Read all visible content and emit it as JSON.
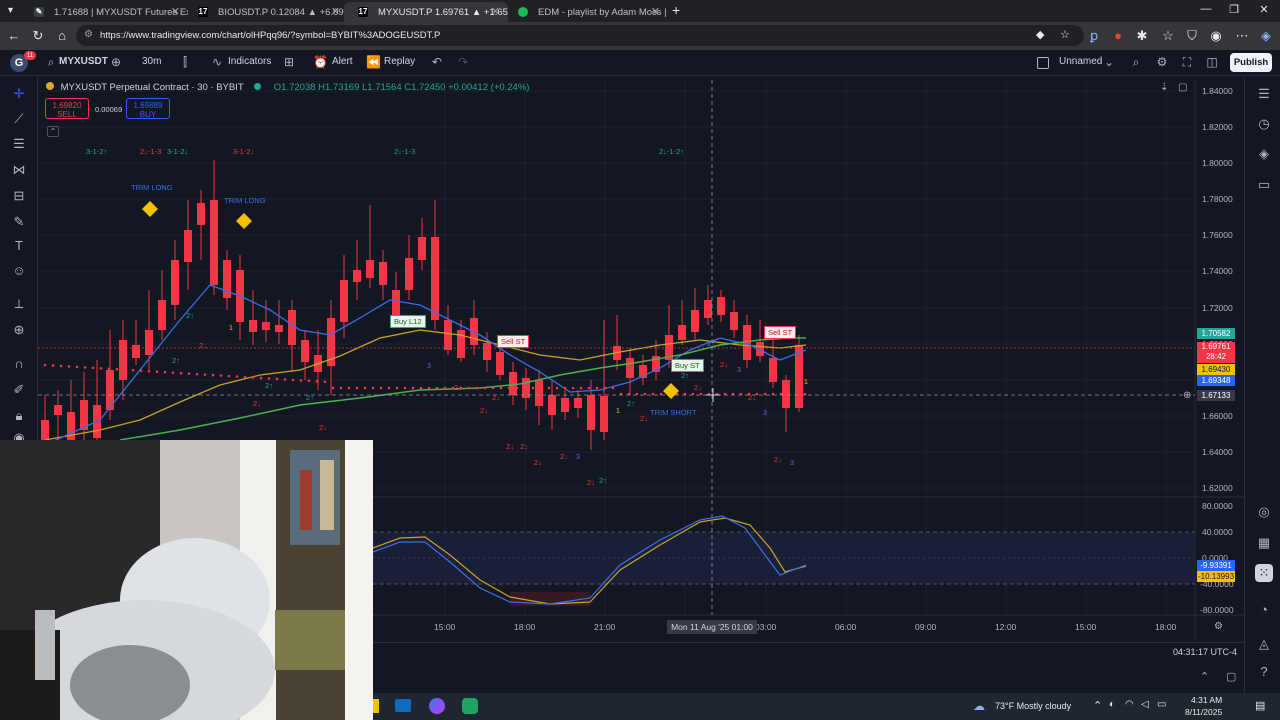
{
  "browser": {
    "tabs": [
      {
        "title": "1.71688 | MYXUSDT Futures Exch",
        "favicon_color": "#3b3f46"
      },
      {
        "title": "BIOUSDT.P 0.12084 ▲ +6.09% Un",
        "favicon_color": "#131722"
      },
      {
        "title": "MYXUSDT.P 1.69761 ▲ +1.65% Un",
        "favicon_color": "#131722"
      },
      {
        "title": "EDM - playlist by Adam Moss | Sp",
        "favicon_color": "#1db954"
      }
    ],
    "new_tab": "+",
    "url": "https://www.tradingview.com/chart/olHPqq96/?symbol=BYBIT%3ADOGEUSDT.P"
  },
  "toolbar": {
    "avatar_letter": "G",
    "avatar_badge": "11",
    "symbol": "MYXUSDT",
    "interval": "30m",
    "indicators": "Indicators",
    "alert": "Alert",
    "replay": "Replay",
    "layout_name": "Unnamed",
    "publish": "Publish"
  },
  "legend": {
    "title": "MYXUSDT Perpetual Contract · 30 · BYBIT",
    "ohlc": "O1.72038  H1.73169  L1.71564  C1.72450  +0.00412 (+0.24%)",
    "sell_price": "1.69820",
    "sell_label": "SELL",
    "spread": "0.00069",
    "buy_price": "1.69889",
    "buy_label": "BUY"
  },
  "annotations": {
    "trim_long_1": "TRIM LONG",
    "trim_long_2": "TRIM LONG",
    "trim_short": "TRIM SHORT",
    "buy_l12": "Buy L12",
    "sell_st_1": "Sell ST",
    "buy_st": "Buy ST",
    "sell_st_2": "Sell ST",
    "tag_1": "3-1-2↑",
    "tag_2": "2↓-1-3",
    "tag_3": "3-1-2↓",
    "tag_4": "3-1-2↓",
    "tag_5": "2↓-1-3",
    "tag_6": "2↓-1-2↑"
  },
  "price_axis": {
    "ticks": [
      "1.84000",
      "1.82000",
      "1.80000",
      "1.78000",
      "1.76000",
      "1.74000",
      "1.72000",
      "1.70000",
      "1.68000",
      "1.66000",
      "1.64000",
      "1.62000"
    ],
    "osc_ticks": [
      "80.0000",
      "40.0000",
      "0.0000",
      "-40.0000",
      "-80.0000"
    ],
    "tag_green": "1.70582",
    "tag_red": "1.69761",
    "tag_countdown": "28:42",
    "tag_yellow": "1.69430",
    "tag_blue": "1.69348",
    "tag_cross": "1.67133",
    "osc_tag_blue": "-9.93391",
    "osc_tag_yellow": "-10.13993"
  },
  "time_axis": {
    "labels": [
      "15:00",
      "18:00",
      "21:00",
      "03:00",
      "06:00",
      "09:00",
      "12:00",
      "15:00",
      "18:00"
    ],
    "cursor_label": "Mon 11 Aug '25   01:00",
    "clock": "04:31:17 UTC-4"
  },
  "taskbar": {
    "weather": "73°F  Mostly cloudy",
    "time": "4:31 AM",
    "date": "8/11/2025"
  },
  "colors": {
    "up": "#26a69a",
    "down": "#f23645",
    "ma_yellow": "#c9a227",
    "ma_blue": "#3c6ee6",
    "ma_green": "#4caf50"
  }
}
